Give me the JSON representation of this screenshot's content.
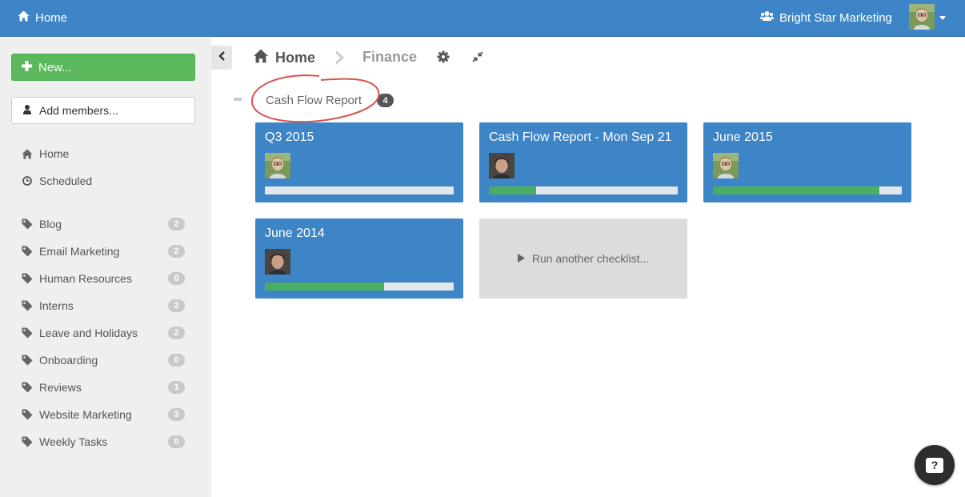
{
  "topbar": {
    "home_label": "Home",
    "org_label": "Bright Star Marketing",
    "brand_color": "#3d85c6"
  },
  "sidebar": {
    "new_label": "New...",
    "add_members_label": "Add members...",
    "nav": [
      {
        "label": "Home",
        "icon": "home-icon"
      },
      {
        "label": "Scheduled",
        "icon": "clock-icon"
      }
    ],
    "tags": [
      {
        "label": "Blog",
        "count": "2"
      },
      {
        "label": "Email Marketing",
        "count": "2"
      },
      {
        "label": "Human Resources",
        "count": "0"
      },
      {
        "label": "Interns",
        "count": "2"
      },
      {
        "label": "Leave and Holidays",
        "count": "2"
      },
      {
        "label": "Onboarding",
        "count": "0"
      },
      {
        "label": "Reviews",
        "count": "1"
      },
      {
        "label": "Website Marketing",
        "count": "3"
      },
      {
        "label": "Weekly Tasks",
        "count": "0"
      }
    ]
  },
  "breadcrumb": {
    "home": "Home",
    "current": "Finance"
  },
  "group": {
    "title": "Cash Flow Report",
    "count": "4",
    "annotation_color": "#d9534f"
  },
  "checklists": [
    {
      "title": "Q3 2015",
      "progress": 0.0,
      "avatar": "avatar-a"
    },
    {
      "title": "Cash Flow Report - Mon Sep 21",
      "progress": 0.25,
      "avatar": "avatar-b"
    },
    {
      "title": "June 2015",
      "progress": 0.88,
      "avatar": "avatar-a"
    },
    {
      "title": "June 2014",
      "progress": 0.63,
      "avatar": "avatar-b"
    }
  ],
  "run_another_label": "Run another checklist...",
  "help_label": "?"
}
